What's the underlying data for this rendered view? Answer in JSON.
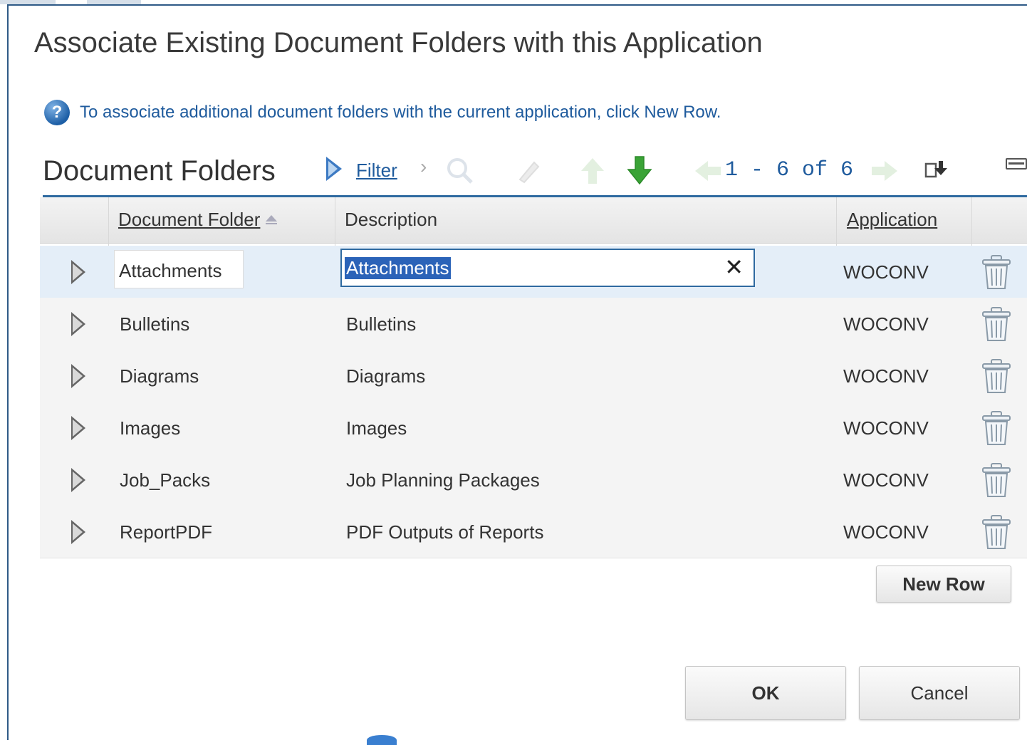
{
  "dialog": {
    "title": "Associate Existing Document Folders with this Application",
    "help_text": "To associate additional document folders with the current application, click New Row."
  },
  "toolbar": {
    "title": "Document Folders",
    "filter_label": "Filter",
    "pager": "1 - 6 of 6",
    "icons": [
      "filter-arrow-icon",
      "chevron-right-icon",
      "search-icon",
      "clear-filter-icon",
      "previous-up-icon",
      "next-down-icon",
      "previous-page-icon",
      "next-page-icon",
      "download-icon",
      "minimize-icon"
    ]
  },
  "table": {
    "columns": [
      "Document Folder",
      "Description",
      "Application"
    ],
    "rows": [
      {
        "folder": "Attachments",
        "description": "Attachments",
        "application": "WOCONV"
      },
      {
        "folder": "Bulletins",
        "description": "Bulletins",
        "application": "WOCONV"
      },
      {
        "folder": "Diagrams",
        "description": "Diagrams",
        "application": "WOCONV"
      },
      {
        "folder": "Images",
        "description": "Images",
        "application": "WOCONV"
      },
      {
        "folder": "Job_Packs",
        "description": "Job Planning Packages",
        "application": "WOCONV"
      },
      {
        "folder": "ReportPDF",
        "description": "PDF Outputs of Reports",
        "application": "WOCONV"
      }
    ],
    "clear_glyph": "✕"
  },
  "buttons": {
    "new_row": "New Row",
    "ok": "OK",
    "cancel": "Cancel"
  },
  "colors": {
    "accent": "#1f5b9d",
    "selected_row": "#e4eef8",
    "selection_highlight": "#2b63b8",
    "green_arrow": "#3aa336"
  }
}
